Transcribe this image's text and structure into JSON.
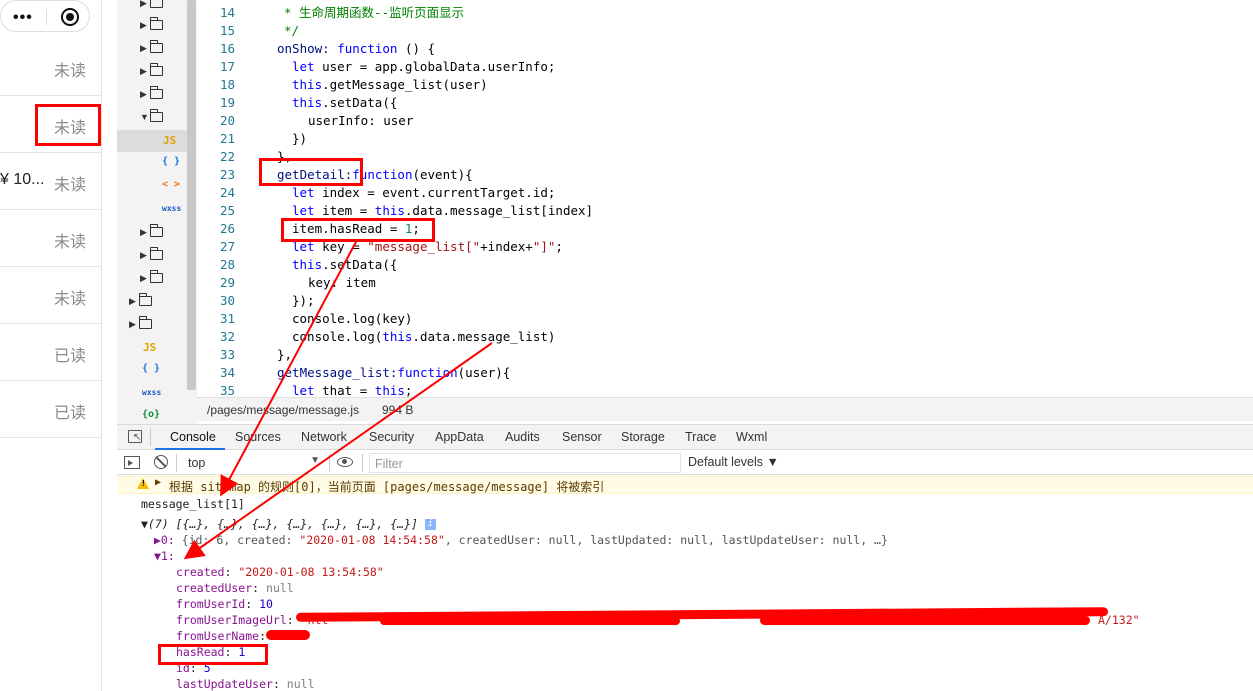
{
  "phone": {
    "capsule_menu_icon": "more-dots-icon",
    "capsule_close_icon": "target-circle-icon",
    "rows": [
      {
        "status": "未读",
        "price": ""
      },
      {
        "status": "未读",
        "price": ""
      },
      {
        "status": "未读",
        "price": "¥ 10..."
      },
      {
        "status": "未读",
        "price": ""
      },
      {
        "status": "未读",
        "price": ""
      },
      {
        "status": "已读",
        "price": ""
      },
      {
        "status": "已读",
        "price": ""
      }
    ]
  },
  "explorer": {
    "icons": {
      "js": "JS",
      "json": "{ }",
      "wxml": "< >",
      "wxss": "wxss",
      "js2": "JS",
      "json2": "{ }",
      "wxss2": "wxss",
      "wxs": "{o}"
    }
  },
  "editor": {
    "line_numbers": [
      "14",
      "15",
      "16",
      "17",
      "18",
      "19",
      "20",
      "21",
      "22",
      "23",
      "24",
      "25",
      "26",
      "27",
      "28",
      "29",
      "30",
      "31",
      "32",
      "33",
      "34",
      "35"
    ],
    "lines": {
      "l14": "* 生命周期函数--监听页面显示",
      "l15": "*/",
      "l16a": "onShow: ",
      "l16b": "function",
      "l16c": " () {",
      "l17a": "let",
      "l17b": " user = app.globalData.userInfo;",
      "l18a": "this",
      "l18b": ".getMessage_list(user)",
      "l19a": "this",
      "l19b": ".setData({",
      "l20": "userInfo: user",
      "l21": "})",
      "l22": "},",
      "l23a": "getDetail:",
      "l23b": "function",
      "l23c": "(event){",
      "l24a": "let",
      "l24b": " index = event.currentTarget.id;",
      "l25a": "let",
      "l25b": " item = ",
      "l25c": "this",
      "l25d": ".data.message_list[index]",
      "l26a": "item.hasRead = ",
      "l26b": "1",
      "l26c": ";",
      "l27a": "let",
      "l27b": " key = ",
      "l27c": "\"message_list[\"",
      "l27d": "+index+",
      "l27e": "\"]\"",
      "l27f": ";",
      "l28a": "this",
      "l28b": ".setData({",
      "l29": "key: item",
      "l30": "});",
      "l31": "console.log(key)",
      "l32a": "console.log(",
      "l32b": "this",
      "l32c": ".data.message_list)",
      "l33": "},",
      "l34a": "getMessage_list:",
      "l34b": "function",
      "l34c": "(user){",
      "l35a": "let",
      "l35b": " that = ",
      "l35c": "this",
      "l35d": ";"
    }
  },
  "statusbar": {
    "path": "/pages/message/message.js",
    "size": "994 B"
  },
  "devtools_tabs": [
    "Console",
    "Sources",
    "Network",
    "Security",
    "AppData",
    "Audits",
    "Sensor",
    "Storage",
    "Trace",
    "Wxml"
  ],
  "console_toolbar": {
    "context": "top",
    "filter_placeholder": "Filter",
    "levels": "Default levels ▼"
  },
  "console": {
    "warning": "根据 sitemap 的规则[0]，当前页面 [pages/message/message] 将被索引",
    "log1": "message_list[1]",
    "array_summary": "▼(7) [{…}, {…}, {…}, {…}, {…}, {…}, {…}]",
    "item0_key": "▶0:",
    "item0_text_a": " {id: 6, created: ",
    "item0_created": "\"2020-01-08 14:54:58\"",
    "item0_text_b": ", createdUser: null, lastUpdated: null, lastUpdateUser: null, …}",
    "item1_key": "▼1:",
    "props": [
      {
        "k": "created",
        "v": "\"2020-01-08 13:54:58\"",
        "cls": "str"
      },
      {
        "k": "createdUser",
        "v": "null",
        "cls": "nul"
      },
      {
        "k": "fromUserId",
        "v": "10",
        "cls": "num"
      },
      {
        "k": "fromUserImageUrl",
        "v": "\"htt",
        "cls": "str"
      },
      {
        "k": "fromUserName",
        "v": "\"",
        "cls": "str"
      },
      {
        "k": "hasRead",
        "v": "1",
        "cls": "num"
      },
      {
        "k": "id",
        "v": "5",
        "cls": "num"
      },
      {
        "k": "lastUpdateUser",
        "v": "null",
        "cls": "nul"
      }
    ],
    "url_tail": "A/132\""
  },
  "annotation_color": "#ff0000"
}
